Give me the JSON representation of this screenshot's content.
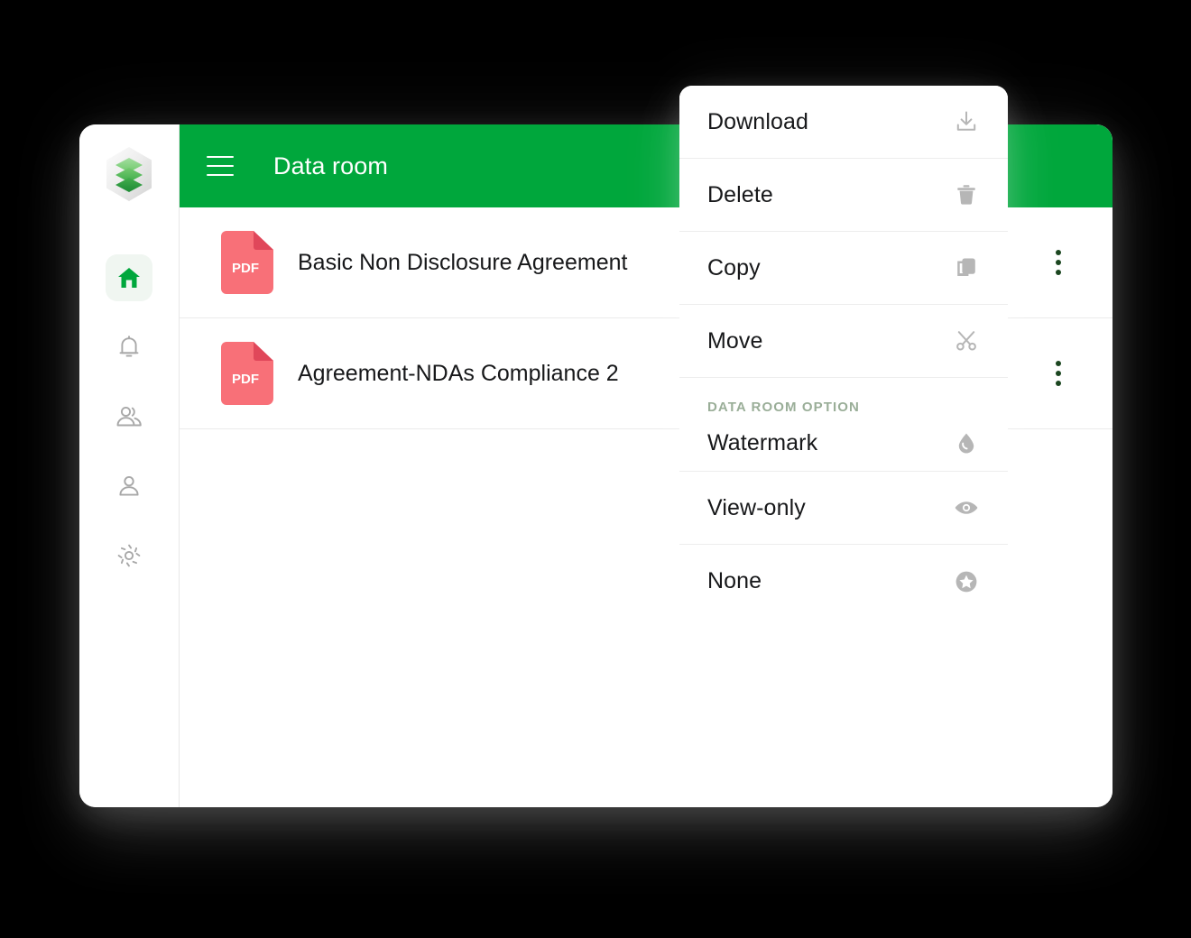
{
  "app": {
    "sidebar": {
      "logo_name": "layers-hexagon-logo",
      "items": [
        {
          "id": "home",
          "label": "Home",
          "icon": "home-icon",
          "active": true
        },
        {
          "id": "alerts",
          "label": "Notifications",
          "icon": "bell-icon",
          "active": false
        },
        {
          "id": "teams",
          "label": "Teams",
          "icon": "people-icon",
          "active": false
        },
        {
          "id": "profile",
          "label": "Profile",
          "icon": "person-icon",
          "active": false
        },
        {
          "id": "settings",
          "label": "Settings",
          "icon": "gear-icon",
          "active": false
        }
      ]
    },
    "topbar": {
      "menu_icon": "hamburger-icon",
      "title": "Data room",
      "background_color": "#00a73c"
    },
    "files": [
      {
        "type": "PDF",
        "name": "Basic Non Disclosure Agreement",
        "menu_icon": "more-vertical-icon"
      },
      {
        "type": "PDF",
        "name": "Agreement-NDAs Compliance 2",
        "menu_icon": "more-vertical-icon"
      }
    ]
  },
  "context_menu": {
    "items": [
      {
        "label": "Download",
        "icon": "download-icon"
      },
      {
        "label": "Delete",
        "icon": "trash-icon"
      },
      {
        "label": "Copy",
        "icon": "copy-icon"
      },
      {
        "label": "Move",
        "icon": "scissors-icon"
      }
    ],
    "section": {
      "title": "DATA ROOM OPTION",
      "title_color": "#9aae98",
      "items": [
        {
          "label": "Watermark",
          "icon": "droplet-icon"
        }
      ]
    },
    "options": [
      {
        "label": "View-only",
        "icon": "eye-icon"
      },
      {
        "label": "None",
        "icon": "star-circle-icon"
      }
    ]
  },
  "colors": {
    "accent_green": "#00a73c",
    "pdf_red": "#f87078",
    "pdf_fold": "#e0475a",
    "dots_green": "#1b4620",
    "icon_grey": "#b6b6b6",
    "background": "#000000"
  }
}
